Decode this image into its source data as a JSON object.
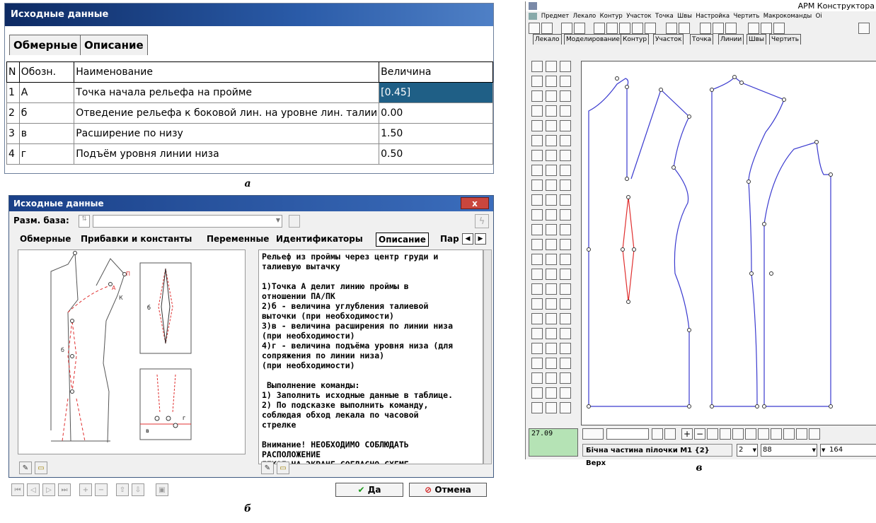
{
  "panel_a": {
    "title": "Исходные данные",
    "tabs": [
      "Обмерные",
      "Описание"
    ],
    "columns": [
      "N",
      "Обозн.",
      "Наименование",
      "Величина"
    ],
    "rows": [
      {
        "n": "1",
        "code": "А",
        "name": "Точка начала рельефа на пройме",
        "value": "[0.45]"
      },
      {
        "n": "2",
        "code": "б",
        "name": "Отведение рельефа к боковой лин. на уровне лин. талии",
        "value": "0.00"
      },
      {
        "n": "3",
        "code": "в",
        "name": "Расширение по низу",
        "value": "1.50"
      },
      {
        "n": "4",
        "code": "г",
        "name": "Подъём уровня линии низа",
        "value": "0.50"
      }
    ],
    "caption": "а"
  },
  "panel_b": {
    "title": "Исходные данные",
    "close_label": "x",
    "size_base_label": "Разм. база:",
    "tabs": [
      "Обмерные",
      "Прибавки и константы",
      "Переменные",
      "Идентификаторы",
      "Описание",
      "Пар"
    ],
    "description": "Рельеф из проймы через центр груди и\nталиевую вытачку\n\n1)Точка А делит линию проймы в\nотношении ПА/ПК\n2)б - величина углубления талиевой\nвыточки (при необходимости)\n3)в - величина расширения по линии низа\n(при необходимости)\n4)г - величина подъёма уровня низа (для\nсопряжения по линии низа)\n(при необходимости)\n\n Выполнение команды:\n1) Заполнить исходные данные в таблице.\n2) По подсказке выполнить команду,\nсоблюдая обход лекала по часовой\nстрелке\n\nВнимание! НЕОБХОДИМО СОБЛЮДАТЬ\nРАСПОЛОЖЕНИЕ\nЛЕКАЛ НА ЭКРАНЕ СОГЛАСНО СХЕМЕ",
    "diagram_labels": {
      "p": "П",
      "a": "А",
      "k": "К",
      "b": "б",
      "v": "в",
      "g": "г"
    },
    "ok_label": "Да",
    "cancel_label": "Отмена",
    "caption": "б"
  },
  "panel_v": {
    "title": "АРМ Конструктора",
    "menu": [
      "Предмет",
      "Лекало",
      "Контур",
      "Участок",
      "Точка",
      "Швы",
      "Настройка",
      "Чертить",
      "Макрокоманды",
      "Оі"
    ],
    "tabs": [
      "Лекало",
      "Моделирование",
      "Контур",
      "Участок",
      "Точка",
      "Линии",
      "Швы",
      "Чертить"
    ],
    "coord": "27.09",
    "status_text": "Бічна частина пілочки М1 {2} Верх",
    "combo1": "2",
    "combo2": "88",
    "combo3": "164",
    "caption": "в",
    "colors": {
      "contour": "#3a3acf",
      "dart": "#e03030"
    }
  }
}
